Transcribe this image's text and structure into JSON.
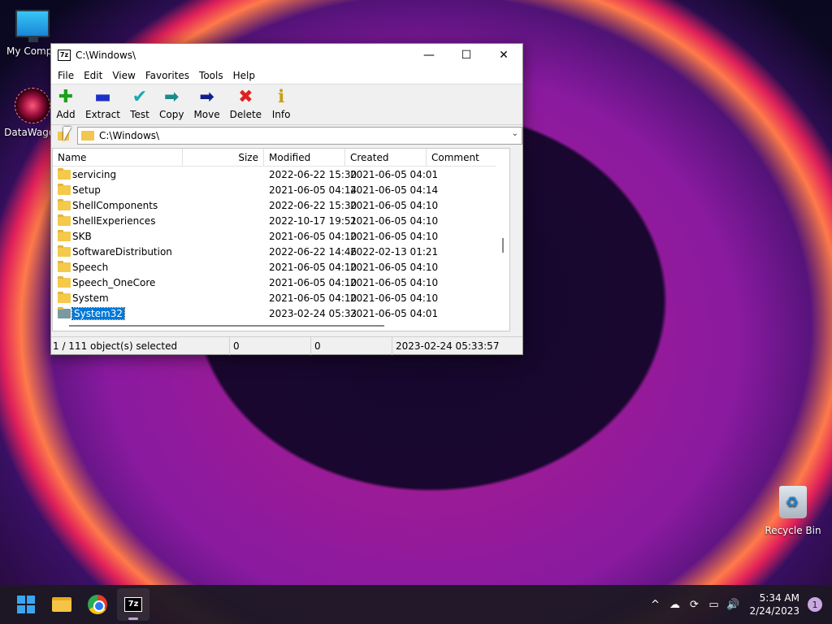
{
  "desktop": {
    "icons": [
      {
        "label": "My Compu"
      },
      {
        "label": "DataWagon"
      },
      {
        "label": "Recycle Bin"
      }
    ]
  },
  "window": {
    "title": "C:\\Windows\\",
    "app_icon_text": "7z",
    "controls": {
      "minimize": "—",
      "maximize": "☐",
      "close": "✕"
    },
    "menu": [
      "File",
      "Edit",
      "View",
      "Favorites",
      "Tools",
      "Help"
    ],
    "toolbar": [
      {
        "label": "Add",
        "icon": "plus-icon",
        "glyph": "✚",
        "color": "#1aa31a"
      },
      {
        "label": "Extract",
        "icon": "minus-icon",
        "glyph": "▬",
        "color": "#1a30c8"
      },
      {
        "label": "Test",
        "icon": "check-icon",
        "glyph": "✔",
        "color": "#18a8b0"
      },
      {
        "label": "Copy",
        "icon": "copy-arrow-icon",
        "glyph": "➡",
        "color": "#1a8a8a"
      },
      {
        "label": "Move",
        "icon": "move-arrow-icon",
        "glyph": "➡",
        "color": "#10208a"
      },
      {
        "label": "Delete",
        "icon": "delete-x-icon",
        "glyph": "✖",
        "color": "#e02020"
      },
      {
        "label": "Info",
        "icon": "info-icon",
        "glyph": "ℹ",
        "color": "#c8a010"
      }
    ],
    "address": "C:\\Windows\\",
    "columns": [
      "Name",
      "Size",
      "Modified",
      "Created",
      "Comment"
    ],
    "rows": [
      {
        "name": "servicing",
        "size": "",
        "modified": "2022-06-22 15:30",
        "created": "2021-06-05 04:01",
        "comment": ""
      },
      {
        "name": "Setup",
        "size": "",
        "modified": "2021-06-05 04:14",
        "created": "2021-06-05 04:14",
        "comment": ""
      },
      {
        "name": "ShellComponents",
        "size": "",
        "modified": "2022-06-22 15:30",
        "created": "2021-06-05 04:10",
        "comment": ""
      },
      {
        "name": "ShellExperiences",
        "size": "",
        "modified": "2022-10-17 19:51",
        "created": "2021-06-05 04:10",
        "comment": ""
      },
      {
        "name": "SKB",
        "size": "",
        "modified": "2021-06-05 04:10",
        "created": "2021-06-05 04:10",
        "comment": ""
      },
      {
        "name": "SoftwareDistribution",
        "size": "",
        "modified": "2022-06-22 14:46",
        "created": "2022-02-13 01:21",
        "comment": ""
      },
      {
        "name": "Speech",
        "size": "",
        "modified": "2021-06-05 04:10",
        "created": "2021-06-05 04:10",
        "comment": ""
      },
      {
        "name": "Speech_OneCore",
        "size": "",
        "modified": "2021-06-05 04:10",
        "created": "2021-06-05 04:10",
        "comment": ""
      },
      {
        "name": "System",
        "size": "",
        "modified": "2021-06-05 04:10",
        "created": "2021-06-05 04:10",
        "comment": ""
      },
      {
        "name": "System32",
        "size": "",
        "modified": "2023-02-24 05:33",
        "created": "2021-06-05 04:01",
        "comment": "",
        "selected": true
      }
    ],
    "status": {
      "selection": "1 / 111 object(s) selected",
      "size": "0",
      "packed": "0",
      "modified": "2023-02-24 05:33:57"
    }
  },
  "taskbar": {
    "apps": [
      {
        "name": "start",
        "icon": "windows-start-icon"
      },
      {
        "name": "explorer",
        "icon": "file-explorer-icon"
      },
      {
        "name": "chrome",
        "icon": "chrome-icon"
      },
      {
        "name": "7zip",
        "icon": "7zip-icon",
        "text": "7z",
        "active": true
      }
    ],
    "tray": {
      "chevron": "^",
      "time": "5:34 AM",
      "date": "2/24/2023",
      "notifications": "1"
    }
  }
}
